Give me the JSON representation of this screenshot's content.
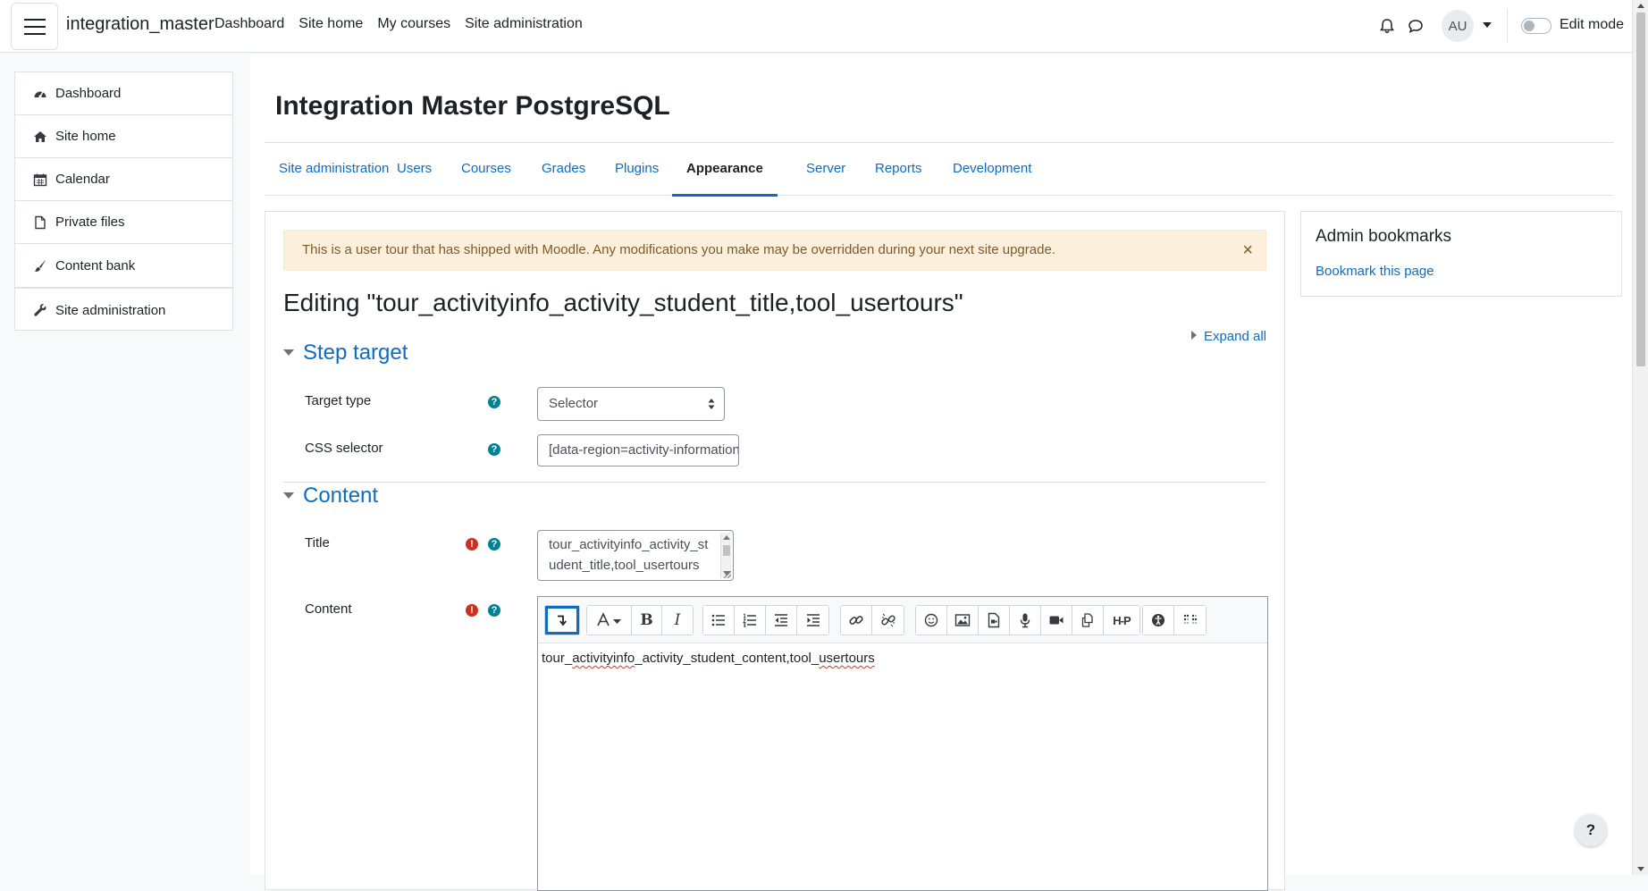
{
  "navbar": {
    "brand": "integration_master",
    "links": [
      "Dashboard",
      "Site home",
      "My courses",
      "Site administration"
    ],
    "avatar_initials": "AU",
    "edit_mode_label": "Edit mode"
  },
  "drawer": {
    "items": [
      {
        "label": "Dashboard",
        "icon": "dashboard-icon"
      },
      {
        "label": "Site home",
        "icon": "home-icon"
      },
      {
        "label": "Calendar",
        "icon": "calendar-icon"
      },
      {
        "label": "Private files",
        "icon": "file-icon"
      },
      {
        "label": "Content bank",
        "icon": "brush-icon"
      }
    ],
    "admin_item": {
      "label": "Site administration",
      "icon": "wrench-icon"
    }
  },
  "page": {
    "title": "Integration Master PostgreSQL",
    "tabs": [
      "Site administration",
      "Users",
      "Courses",
      "Grades",
      "Plugins",
      "Appearance",
      "Server",
      "Reports",
      "Development"
    ],
    "active_tab": "Appearance"
  },
  "alert": {
    "text": "This is a user tour that has shipped with Moodle. Any modifications you make may be overridden during your next site upgrade.",
    "close": "×"
  },
  "form": {
    "heading": "Editing \"tour_activityinfo_activity_student_title,tool_usertours\"",
    "expand_all": "Expand all",
    "step_target": {
      "header": "Step target",
      "target_type_label": "Target type",
      "target_type_value": "Selector",
      "css_selector_label": "CSS selector",
      "css_selector_value": "[data-region=activity-information]"
    },
    "content_section": {
      "header": "Content",
      "title_label": "Title",
      "title_value": "tour_activityinfo_activity_student_title,tool_usertours",
      "content_label": "Content",
      "editor": {
        "content_parts": [
          "tour_",
          "activityinfo",
          "_activity_student_content,tool_",
          "usertours"
        ],
        "bold": "B",
        "italic": "I",
        "h5p": "H-P"
      }
    }
  },
  "block": {
    "title": "Admin bookmarks",
    "link": "Bookmark this page"
  },
  "help_fab": "?"
}
